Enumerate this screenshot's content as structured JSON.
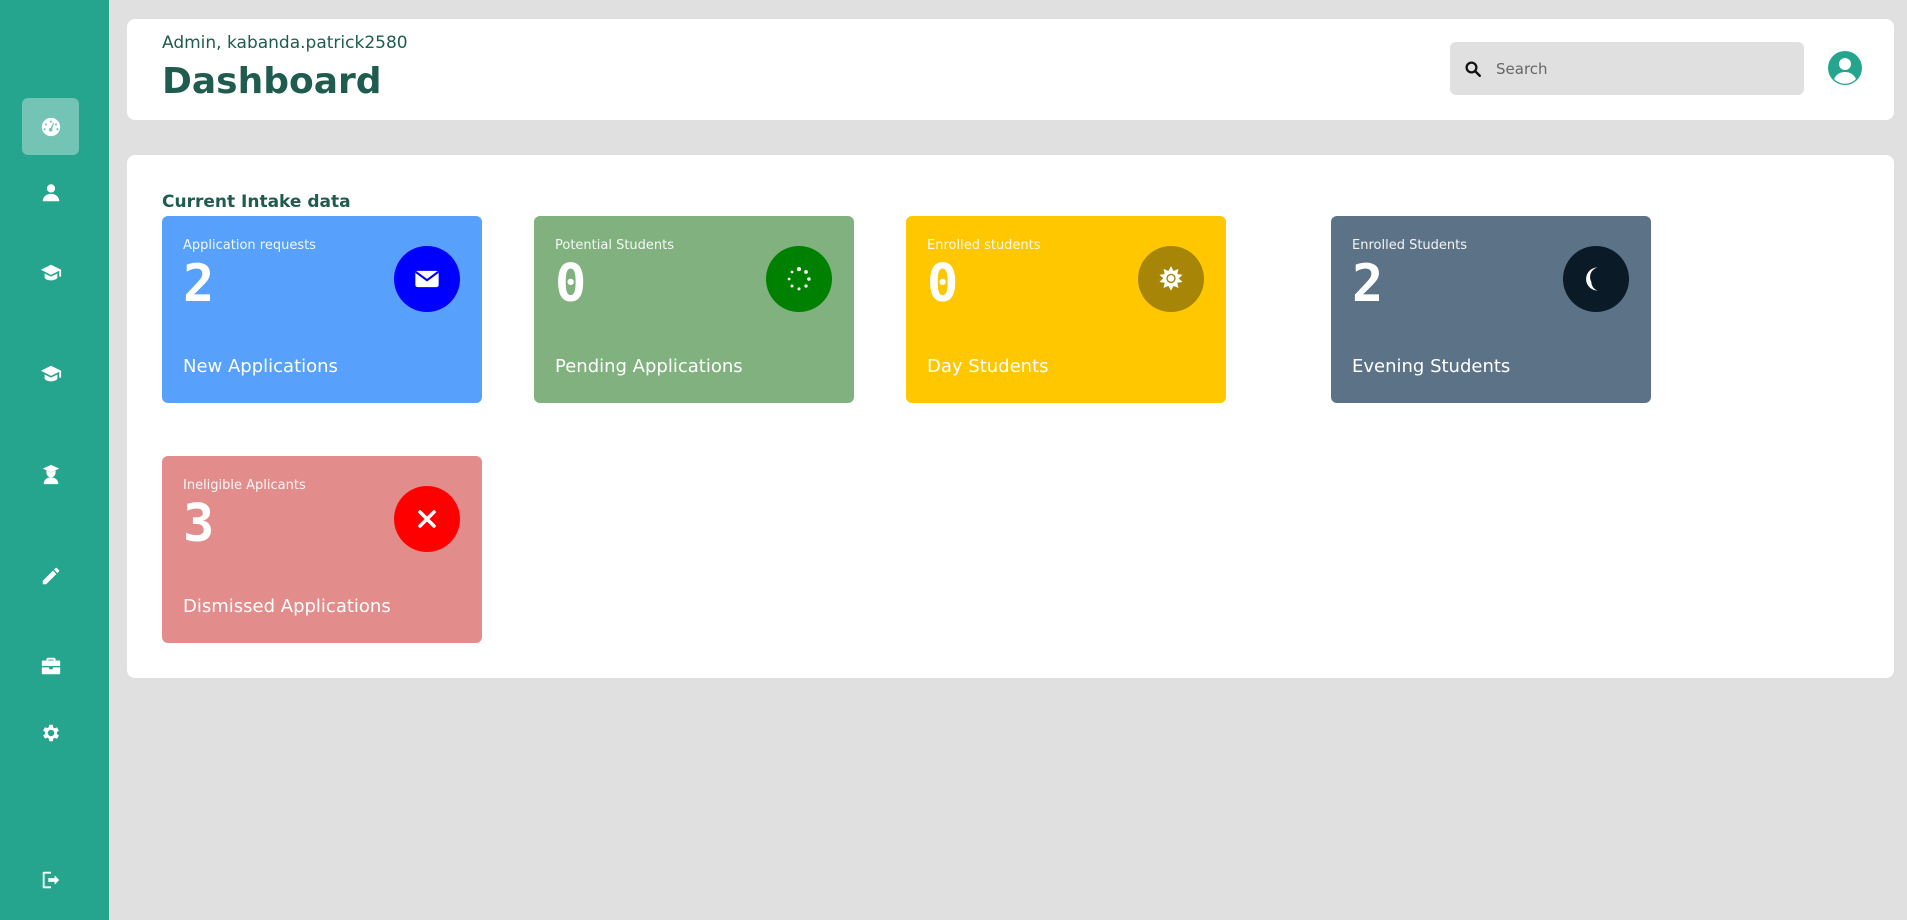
{
  "header": {
    "greeting": "Admin, kabanda.patrick2580",
    "title": "Dashboard",
    "search_placeholder": "Search"
  },
  "sidebar": {
    "items": [
      {
        "icon": "dashboard-icon",
        "active": true
      },
      {
        "icon": "user-icon"
      },
      {
        "icon": "graduation-cap-icon"
      },
      {
        "icon": "graduation-cap-icon"
      },
      {
        "icon": "user-graduate-icon"
      },
      {
        "icon": "pencil-icon"
      },
      {
        "icon": "briefcase-icon"
      },
      {
        "icon": "gear-icon"
      },
      {
        "icon": "sign-out-icon"
      }
    ]
  },
  "main": {
    "section_title": "Current Intake data",
    "cards": [
      {
        "label": "Application requests",
        "value": "2",
        "title": "New Applications",
        "color": "#57a0fb",
        "icon_color": "#0000ff",
        "icon": "envelope-icon"
      },
      {
        "label": "Potential Students",
        "value": "0",
        "title": "Pending Applications",
        "color": "#80b17e",
        "icon_color": "#008000",
        "icon": "spinner-icon"
      },
      {
        "label": "Enrolled students",
        "value": "0",
        "title": "Day Students",
        "color": "#ffc700",
        "icon_color": "#a68507",
        "icon": "sun-icon"
      },
      {
        "label": "Enrolled Students",
        "value": "2",
        "title": "Evening Students",
        "color": "#5c7387",
        "icon_color": "#0a1a26",
        "icon": "moon-icon"
      },
      {
        "label": "Ineligible Aplicants",
        "value": "3",
        "title": "Dismissed Applications",
        "color": "#e28c8c",
        "icon_color": "#ff0000",
        "icon": "close-icon"
      }
    ]
  }
}
